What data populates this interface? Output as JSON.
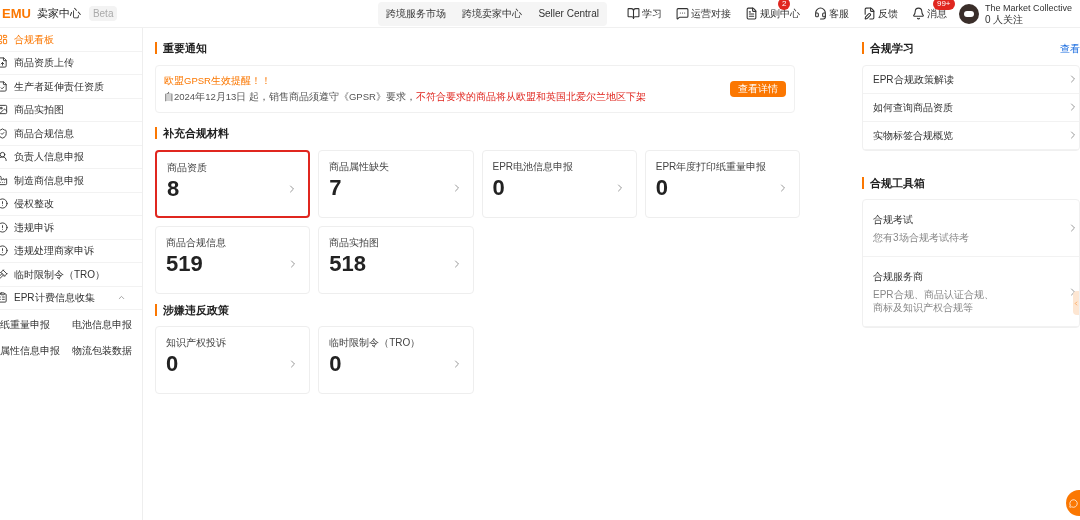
{
  "header": {
    "logo": "EMU",
    "title": "卖家中心",
    "badge": "Beta",
    "nav_links": [
      "跨境服务市场",
      "跨境卖家中心",
      "Seller Central"
    ],
    "tools": [
      {
        "kind": "book",
        "label": "学习"
      },
      {
        "kind": "chat",
        "label": "运营对接"
      },
      {
        "kind": "doc",
        "label": "规则中心",
        "count": "2"
      },
      {
        "kind": "headset",
        "label": "客服"
      },
      {
        "kind": "edit",
        "label": "反馈"
      },
      {
        "kind": "bell",
        "label": "消息",
        "count": "99+"
      }
    ],
    "account": {
      "name": "The Market Collective",
      "followers": "0 人关注"
    }
  },
  "sidebar": {
    "items": [
      {
        "label": "合规看板",
        "selected": true
      },
      {
        "label": "商品资质上传",
        "selected": false
      },
      {
        "label": "生产者延伸责任资质",
        "selected": false
      },
      {
        "label": "商品实拍图",
        "selected": false
      },
      {
        "label": "商品合规信息",
        "selected": false
      },
      {
        "label": "负责人信息申报",
        "selected": false
      },
      {
        "label": "制造商信息申报",
        "selected": false
      },
      {
        "label": "侵权整改",
        "selected": false
      },
      {
        "label": "违规申诉",
        "selected": false
      },
      {
        "label": "违规处理商家申诉",
        "selected": false
      },
      {
        "label": "临时限制令（TRO）",
        "selected": false
      },
      {
        "label": "EPR计费信息收集",
        "selected": false,
        "expanded": true,
        "children": [
          "纸重量申报",
          "电池信息申报",
          "属性信息申报",
          "物流包装数据"
        ]
      }
    ]
  },
  "notice": {
    "title": "重要通知",
    "heading": "欧盟GPSR生效提醒！！",
    "text": "自2024年12月13日 起，销售商品须遵守《GPSR》要求，",
    "warning": "不符合要求的商品将从欧盟和英国北爱尔兰地区下架",
    "button": "查看详情"
  },
  "sections": [
    {
      "title": "补充合规材料",
      "cards": [
        {
          "label": "商品资质",
          "value": "8",
          "highlighted": true
        },
        {
          "label": "商品属性缺失",
          "value": "7",
          "highlighted": false
        },
        {
          "label": "EPR电池信息申报",
          "value": "0",
          "highlighted": false
        },
        {
          "label": "EPR年度打印纸重量申报",
          "value": "0",
          "highlighted": false
        },
        {
          "label": "商品合规信息",
          "value": "519",
          "highlighted": false
        },
        {
          "label": "商品实拍图",
          "value": "518",
          "highlighted": false
        }
      ]
    },
    {
      "title": "涉嫌违反政策",
      "cards": [
        {
          "label": "知识产权投诉",
          "value": "0",
          "highlighted": false
        },
        {
          "label": "临时限制令（TRO）",
          "value": "0",
          "highlighted": false
        }
      ]
    }
  ],
  "learning": {
    "title": "合规学习",
    "more": "查看",
    "items": [
      "EPR合规政策解读",
      "如何查询商品资质",
      "实物标签合规概览"
    ]
  },
  "toolbox": {
    "title": "合规工具箱",
    "items": [
      {
        "title": "合规考试",
        "desc": "您有3场合规考试待考"
      },
      {
        "title": "合规服务商",
        "desc": "EPR合规、商品认证合规、商标及知识产权合规等"
      }
    ]
  }
}
